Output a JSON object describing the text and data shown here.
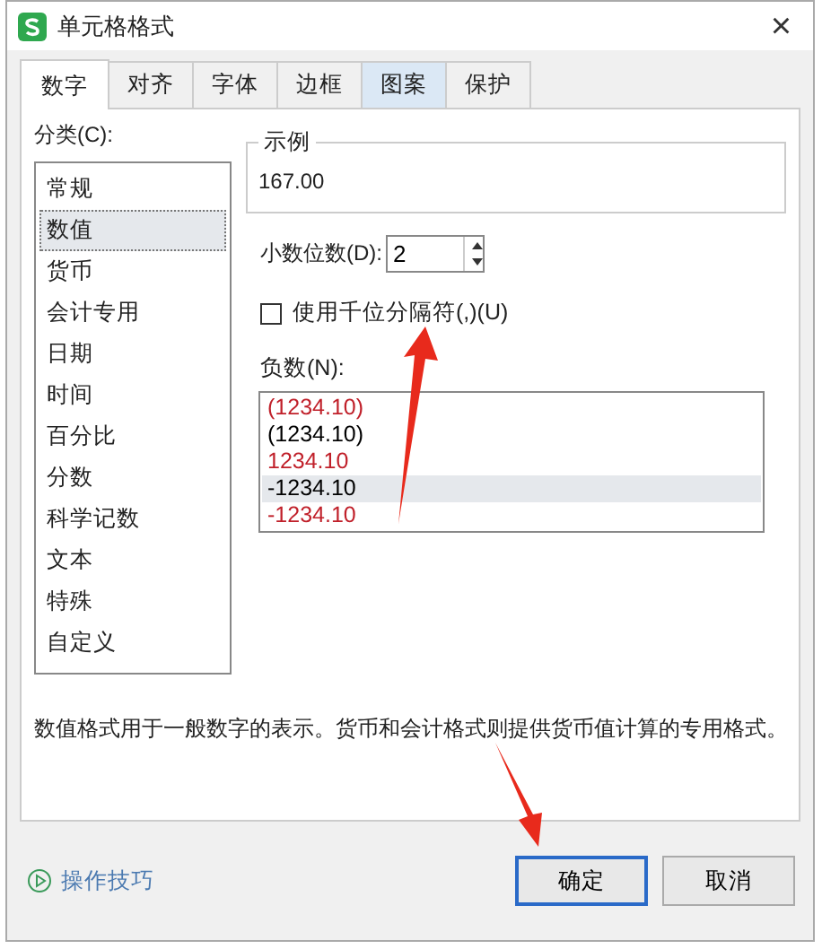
{
  "window": {
    "title": "单元格格式",
    "close": "×"
  },
  "tabs": [
    {
      "label": "数字",
      "selected": true,
      "highlighted": false
    },
    {
      "label": "对齐",
      "selected": false,
      "highlighted": false
    },
    {
      "label": "字体",
      "selected": false,
      "highlighted": false
    },
    {
      "label": "边框",
      "selected": false,
      "highlighted": false
    },
    {
      "label": "图案",
      "selected": false,
      "highlighted": true
    },
    {
      "label": "保护",
      "selected": false,
      "highlighted": false
    }
  ],
  "category": {
    "label": "分类(C):",
    "items": [
      {
        "label": "常规",
        "selected": false
      },
      {
        "label": "数值",
        "selected": true
      },
      {
        "label": "货币",
        "selected": false
      },
      {
        "label": "会计专用",
        "selected": false
      },
      {
        "label": "日期",
        "selected": false
      },
      {
        "label": "时间",
        "selected": false
      },
      {
        "label": "百分比",
        "selected": false
      },
      {
        "label": "分数",
        "selected": false
      },
      {
        "label": "科学记数",
        "selected": false
      },
      {
        "label": "文本",
        "selected": false
      },
      {
        "label": "特殊",
        "selected": false
      },
      {
        "label": "自定义",
        "selected": false
      }
    ]
  },
  "sample": {
    "label": "示例",
    "value": "167.00"
  },
  "decimal_places": {
    "label": "小数位数(D):",
    "value": "2"
  },
  "thousands_separator": {
    "label": "使用千位分隔符(,)(U)",
    "checked": false
  },
  "negative_numbers": {
    "label": "负数(N):",
    "items": [
      {
        "text": "(1234.10)",
        "color": "#c0202a",
        "selected": false
      },
      {
        "text": "(1234.10)",
        "color": "#000000",
        "selected": false
      },
      {
        "text": "1234.10",
        "color": "#c0202a",
        "selected": false
      },
      {
        "text": "-1234.10",
        "color": "#000000",
        "selected": true
      },
      {
        "text": "-1234.10",
        "color": "#c0202a",
        "selected": false
      }
    ]
  },
  "description": "数值格式用于一般数字的表示。货币和会计格式则提供货币值计算的专用格式。",
  "tips_link": "操作技巧",
  "buttons": [
    {
      "label": "确定",
      "kind": "primary"
    },
    {
      "label": "取消",
      "kind": "normal"
    }
  ]
}
